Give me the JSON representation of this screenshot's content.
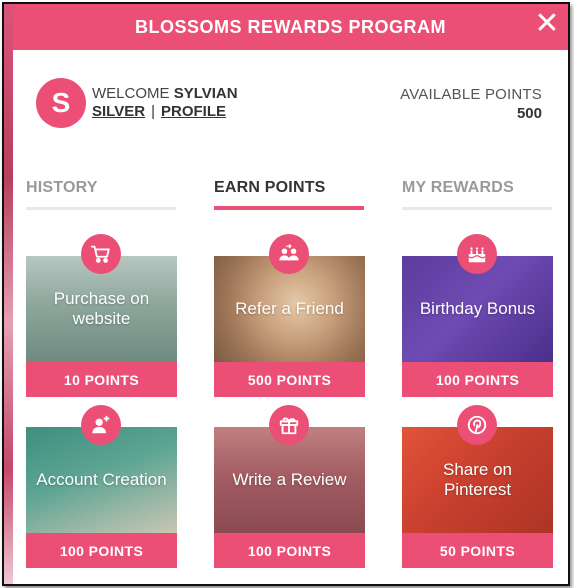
{
  "header": {
    "title": "BLOSSOMS REWARDS PROGRAM",
    "close_symbol": "✕"
  },
  "user": {
    "avatar_initial": "S",
    "welcome_label": "WELCOME",
    "name": "SYLVIAN",
    "tier_link": "SILVER",
    "separator": "|",
    "profile_link": "PROFILE"
  },
  "points": {
    "label": "AVAILABLE POINTS",
    "value": "500"
  },
  "tabs": [
    {
      "label": "HISTORY",
      "active": false
    },
    {
      "label": "EARN POINTS",
      "active": true
    },
    {
      "label": "MY REWARDS",
      "active": false
    }
  ],
  "cards": [
    {
      "label": "Purchase on website",
      "points": "10 POINTS",
      "icon": "cart-icon"
    },
    {
      "label": "Refer a Friend",
      "points": "500 POINTS",
      "icon": "refer-friend-icon"
    },
    {
      "label": "Birthday Bonus",
      "points": "100 POINTS",
      "icon": "birthday-cake-icon"
    },
    {
      "label": "Account Creation",
      "points": "100 POINTS",
      "icon": "add-user-icon"
    },
    {
      "label": "Write a Review",
      "points": "100 POINTS",
      "icon": "gift-icon"
    },
    {
      "label": "Share on Pinterest",
      "points": "50 POINTS",
      "icon": "pinterest-icon"
    }
  ],
  "colors": {
    "accent": "#ec4f75",
    "text_dark": "#333333",
    "tab_inactive": "#999999"
  }
}
